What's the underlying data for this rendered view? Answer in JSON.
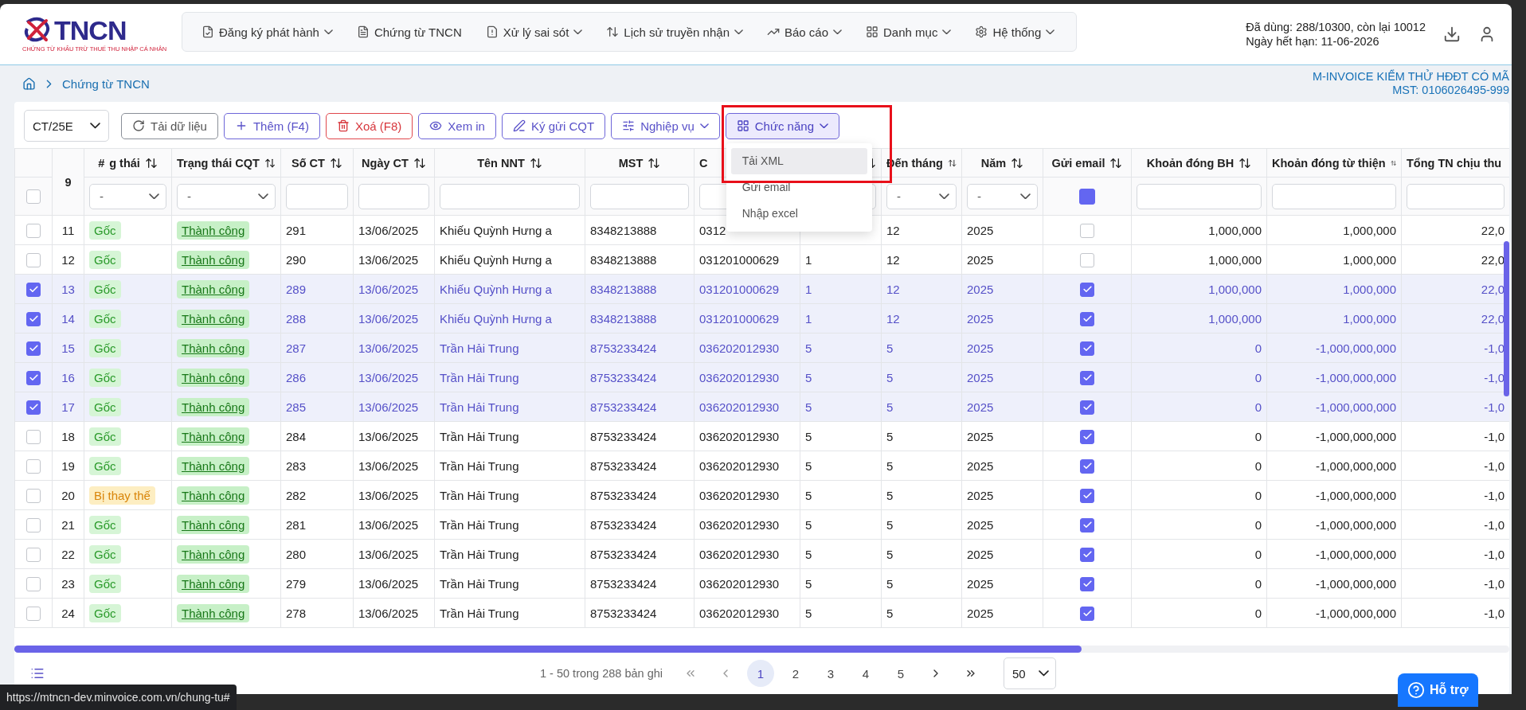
{
  "header": {
    "logo_text": "TNCN",
    "logo_subtitle": "CHỨNG TỪ KHẤU TRỪ THUẾ THU NHẬP CÁ NHÂN",
    "nav": [
      {
        "label": "Đăng ký phát hành",
        "has_menu": true
      },
      {
        "label": "Chứng từ TNCN",
        "has_menu": false
      },
      {
        "label": "Xử lý sai sót",
        "has_menu": true
      },
      {
        "label": "Lịch sử truyền nhận",
        "has_menu": true
      },
      {
        "label": "Báo cáo",
        "has_menu": true
      },
      {
        "label": "Danh mục",
        "has_menu": true
      },
      {
        "label": "Hệ thống",
        "has_menu": true
      }
    ],
    "usage": "Đã dùng: 288/10300, còn lại 10012",
    "expiry": "Ngày hết hạn: 11-06-2026"
  },
  "breadcrumb": {
    "current": "Chứng từ TNCN"
  },
  "company": {
    "name": "M-INVOICE KIỂM THỬ HĐĐT CÓ MÃ",
    "tax_code": "MST: 0106026495-999"
  },
  "toolbar": {
    "series": "CT/25E",
    "buttons": [
      {
        "label": "Tải dữ liệu",
        "kind": "neutral",
        "has_menu": false
      },
      {
        "label": "Thêm (F4)",
        "kind": "primary",
        "has_menu": false
      },
      {
        "label": "Xoá (F8)",
        "kind": "danger",
        "has_menu": false
      },
      {
        "label": "Xem in",
        "kind": "primary",
        "has_menu": false
      },
      {
        "label": "Ký gửi CQT",
        "kind": "primary",
        "has_menu": false
      },
      {
        "label": "Nghiệp vụ",
        "kind": "primary",
        "has_menu": true
      },
      {
        "label": "Chức năng",
        "kind": "active",
        "has_menu": true
      }
    ]
  },
  "function_menu": {
    "open": true,
    "items": [
      {
        "label": "Tải XML",
        "selected": true
      },
      {
        "label": "Gửi email",
        "selected": false
      },
      {
        "label": "Nhập excel",
        "selected": false
      }
    ]
  },
  "table": {
    "select_all": false,
    "columns": [
      {
        "label": "9",
        "kind": "index",
        "sortable": false
      },
      {
        "label": "#",
        "label_2": "g thái",
        "kind": "status",
        "sortable": true,
        "filter": {
          "kind": "select",
          "value": "-"
        }
      },
      {
        "label": "Trạng thái CQT",
        "kind": "cqt",
        "sortable": true,
        "filter": {
          "kind": "select",
          "value": "-"
        }
      },
      {
        "label": "Số CT",
        "kind": "text",
        "sortable": true,
        "filter": {
          "kind": "input"
        }
      },
      {
        "label": "Ngày CT",
        "kind": "text",
        "sortable": true,
        "filter": {
          "kind": "input"
        }
      },
      {
        "label": "Tên NNT",
        "kind": "text",
        "sortable": true,
        "filter": {
          "kind": "input"
        }
      },
      {
        "label": "MST",
        "kind": "text",
        "sortable": true,
        "filter": {
          "kind": "input"
        }
      },
      {
        "label": "C",
        "kind": "text",
        "sortable": false,
        "filter": {
          "kind": "input"
        }
      },
      {
        "kind": "text",
        "sortable": true,
        "filter": {
          "kind": "input"
        }
      },
      {
        "label": "Đến tháng",
        "kind": "text",
        "sortable": true,
        "filter": {
          "kind": "select",
          "value": "-"
        }
      },
      {
        "label": "Năm",
        "kind": "text",
        "sortable": true,
        "filter": {
          "kind": "select",
          "value": "-"
        }
      },
      {
        "label": "Gửi email",
        "kind": "email",
        "sortable": true,
        "filter": {
          "kind": "checkbox",
          "checked": true
        }
      },
      {
        "label": "Khoản đóng BH",
        "kind": "number",
        "sortable": true,
        "filter": {
          "kind": "input"
        }
      },
      {
        "label": "Khoản đóng từ thiện",
        "kind": "number",
        "sortable": true,
        "filter": {
          "kind": "input"
        }
      },
      {
        "label": "Tổng TN chịu thu",
        "kind": "number",
        "filter": {
          "kind": "input"
        }
      }
    ],
    "rows": [
      {
        "selected": false,
        "cells": [
          "11",
          {
            "label": "Gốc",
            "kind": "original"
          },
          {
            "label": "Thành công",
            "kind": "success"
          },
          "291",
          "13/06/2025",
          "Khiếu Quỳnh Hưng a",
          "8348213888",
          "0312",
          null,
          "12",
          "2025",
          {
            "checked": false
          },
          "1,000,000",
          "1,000,000",
          "22,0"
        ]
      },
      {
        "selected": false,
        "cells": [
          "12",
          {
            "label": "Gốc",
            "kind": "original"
          },
          {
            "label": "Thành công",
            "kind": "success"
          },
          "290",
          "13/06/2025",
          "Khiếu Quỳnh Hưng a",
          "8348213888",
          "031201000629",
          "1",
          "12",
          "2025",
          {
            "checked": false
          },
          "1,000,000",
          "1,000,000",
          "22,0"
        ]
      },
      {
        "selected": true,
        "cells": [
          "13",
          {
            "label": "Gốc",
            "kind": "original"
          },
          {
            "label": "Thành công",
            "kind": "success"
          },
          "289",
          "13/06/2025",
          "Khiếu Quỳnh Hưng a",
          "8348213888",
          "031201000629",
          "1",
          "12",
          "2025",
          {
            "checked": true
          },
          "1,000,000",
          "1,000,000",
          "22,0"
        ]
      },
      {
        "selected": true,
        "cells": [
          "14",
          {
            "label": "Gốc",
            "kind": "original"
          },
          {
            "label": "Thành công",
            "kind": "success"
          },
          "288",
          "13/06/2025",
          "Khiếu Quỳnh Hưng a",
          "8348213888",
          "031201000629",
          "1",
          "12",
          "2025",
          {
            "checked": true
          },
          "1,000,000",
          "1,000,000",
          "22,0"
        ]
      },
      {
        "selected": true,
        "cells": [
          "15",
          {
            "label": "Gốc",
            "kind": "original"
          },
          {
            "label": "Thành công",
            "kind": "success"
          },
          "287",
          "13/06/2025",
          "Trần Hải Trung",
          "8753233424",
          "036202012930",
          "5",
          "5",
          "2025",
          {
            "checked": true
          },
          "0",
          "-1,000,000,000",
          "-1,0"
        ]
      },
      {
        "selected": true,
        "cells": [
          "16",
          {
            "label": "Gốc",
            "kind": "original"
          },
          {
            "label": "Thành công",
            "kind": "success"
          },
          "286",
          "13/06/2025",
          "Trần Hải Trung",
          "8753233424",
          "036202012930",
          "5",
          "5",
          "2025",
          {
            "checked": true
          },
          "0",
          "-1,000,000,000",
          "-1,0"
        ]
      },
      {
        "selected": true,
        "cells": [
          "17",
          {
            "label": "Gốc",
            "kind": "original"
          },
          {
            "label": "Thành công",
            "kind": "success"
          },
          "285",
          "13/06/2025",
          "Trần Hải Trung",
          "8753233424",
          "036202012930",
          "5",
          "5",
          "2025",
          {
            "checked": true
          },
          "0",
          "-1,000,000,000",
          "-1,0"
        ]
      },
      {
        "selected": false,
        "cells": [
          "18",
          {
            "label": "Gốc",
            "kind": "original"
          },
          {
            "label": "Thành công",
            "kind": "success"
          },
          "284",
          "13/06/2025",
          "Trần Hải Trung",
          "8753233424",
          "036202012930",
          "5",
          "5",
          "2025",
          {
            "checked": true
          },
          "0",
          "-1,000,000,000",
          "-1,0"
        ]
      },
      {
        "selected": false,
        "cells": [
          "19",
          {
            "label": "Gốc",
            "kind": "original"
          },
          {
            "label": "Thành công",
            "kind": "success"
          },
          "283",
          "13/06/2025",
          "Trần Hải Trung",
          "8753233424",
          "036202012930",
          "5",
          "5",
          "2025",
          {
            "checked": true
          },
          "0",
          "-1,000,000,000",
          "-1,0"
        ]
      },
      {
        "selected": false,
        "cells": [
          "20",
          {
            "label": "Bị thay thế",
            "kind": "replaced"
          },
          {
            "label": "Thành công",
            "kind": "success"
          },
          "282",
          "13/06/2025",
          "Trần Hải Trung",
          "8753233424",
          "036202012930",
          "5",
          "5",
          "2025",
          {
            "checked": true
          },
          "0",
          "-1,000,000,000",
          "-1,0"
        ]
      },
      {
        "selected": false,
        "cells": [
          "21",
          {
            "label": "Gốc",
            "kind": "original"
          },
          {
            "label": "Thành công",
            "kind": "success"
          },
          "281",
          "13/06/2025",
          "Trần Hải Trung",
          "8753233424",
          "036202012930",
          "5",
          "5",
          "2025",
          {
            "checked": true
          },
          "0",
          "-1,000,000,000",
          "-1,0"
        ]
      },
      {
        "selected": false,
        "cells": [
          "22",
          {
            "label": "Gốc",
            "kind": "original"
          },
          {
            "label": "Thành công",
            "kind": "success"
          },
          "280",
          "13/06/2025",
          "Trần Hải Trung",
          "8753233424",
          "036202012930",
          "5",
          "5",
          "2025",
          {
            "checked": true
          },
          "0",
          "-1,000,000,000",
          "-1,0"
        ]
      },
      {
        "selected": false,
        "cells": [
          "23",
          {
            "label": "Gốc",
            "kind": "original"
          },
          {
            "label": "Thành công",
            "kind": "success"
          },
          "279",
          "13/06/2025",
          "Trần Hải Trung",
          "8753233424",
          "036202012930",
          "5",
          "5",
          "2025",
          {
            "checked": true
          },
          "0",
          "-1,000,000,000",
          "-1,0"
        ]
      },
      {
        "selected": false,
        "cells": [
          "24",
          {
            "label": "Gốc",
            "kind": "original"
          },
          {
            "label": "Thành công",
            "kind": "success"
          },
          "278",
          "13/06/2025",
          "Trần Hải Trung",
          "8753233424",
          "036202012930",
          "5",
          "5",
          "2025",
          {
            "checked": true
          },
          "0",
          "-1,000,000,000",
          "-1,0"
        ]
      }
    ]
  },
  "pagination": {
    "summary": "1 - 50 trong 288 bản ghi",
    "pages": [
      {
        "label": "1",
        "selected": true
      },
      {
        "label": "2",
        "selected": false
      },
      {
        "label": "3",
        "selected": false
      },
      {
        "label": "4",
        "selected": false
      },
      {
        "label": "5",
        "selected": false
      }
    ],
    "page_size": "50"
  },
  "help": {
    "label": "Hỗ trợ"
  },
  "status_url": "https://mtncn-dev.minvoice.com.vn/chung-tu#"
}
